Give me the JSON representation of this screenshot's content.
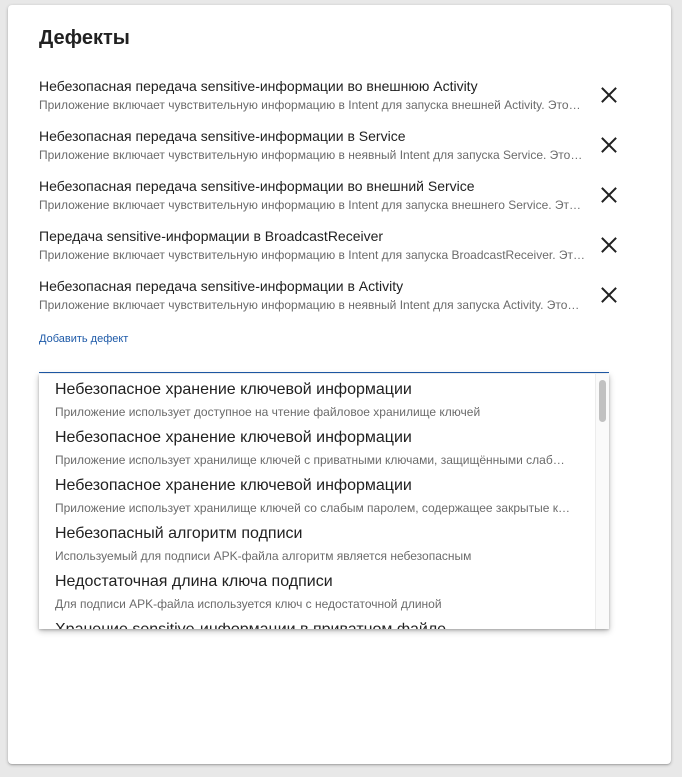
{
  "page": {
    "title": "Дефекты",
    "add_defect_label": "Добавить дефект"
  },
  "defects": [
    {
      "title": "Небезопасная передача sensitive-информации во внешнюю Activity",
      "description": "Приложение включает чувствительную информацию в Intent для запуска внешней Activity. Это…"
    },
    {
      "title": "Небезопасная передача sensitive-информации в Service",
      "description": "Приложение включает чувствительную информацию в неявный Intent для запуска Service. Это…"
    },
    {
      "title": "Небезопасная передача sensitive-информации во внешний Service",
      "description": "Приложение включает чувствительную информацию в Intent для запуска внешнего Service. Эт…"
    },
    {
      "title": "Передача sensitive-информации в BroadcastReceiver",
      "description": "Приложение включает чувствительную информацию в Intent для запуска BroadcastReceiver. Эт…"
    },
    {
      "title": "Небезопасная передача sensitive-информации в Activity",
      "description": "Приложение включает чувствительную информацию в неявный Intent для запуска Activity. Это…"
    }
  ],
  "dropdown": {
    "options": [
      {
        "title": "Небезопасное хранение ключевой информации",
        "description": "Приложение использует доступное на чтение файловое хранилище ключей"
      },
      {
        "title": "Небезопасное хранение ключевой информации",
        "description": "Приложение использует хранилище ключей с приватными ключами, защищёнными слаб…"
      },
      {
        "title": "Небезопасное хранение ключевой информации",
        "description": "Приложение использует хранилище ключей со слабым паролем, содержащее закрытые к…"
      },
      {
        "title": "Небезопасный алгоритм подписи",
        "description": "Используемый для подписи APK-файла алгоритм является небезопасным"
      },
      {
        "title": "Недостаточная длина ключа подписи",
        "description": "Для подписи APK-файла используется ключ с недостаточной длиной"
      },
      {
        "title": "Хранение sensitive-информации в приватном файле",
        "description": ""
      }
    ]
  },
  "icons": {
    "remove": "close-icon"
  },
  "colors": {
    "accent": "#1e5aa8",
    "text_primary": "#212121",
    "text_secondary": "#6b6b6b",
    "background": "#e8e8e8",
    "card": "#ffffff"
  }
}
